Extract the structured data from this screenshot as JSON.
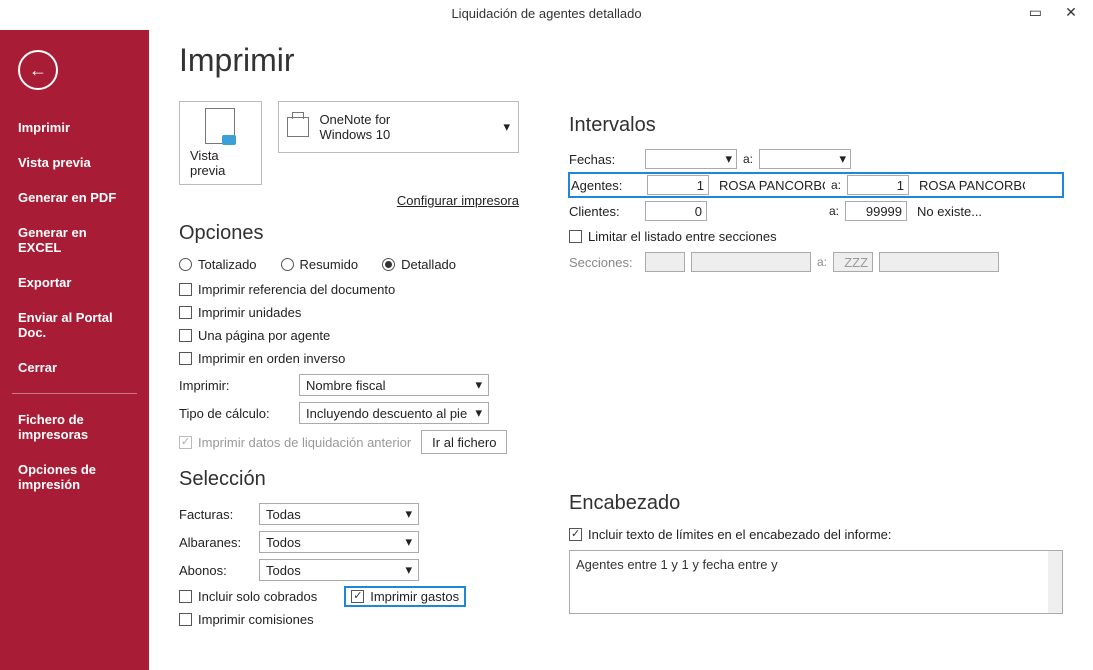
{
  "window": {
    "title": "Liquidación de agentes detallado"
  },
  "sidebar": {
    "items": [
      "Imprimir",
      "Vista previa",
      "Generar en PDF",
      "Generar en EXCEL",
      "Exportar",
      "Enviar al Portal Doc.",
      "Cerrar"
    ],
    "extra": [
      "Fichero de impresoras",
      "Opciones de impresión"
    ]
  },
  "page": {
    "title": "Imprimir",
    "preview_label": "Vista previa",
    "printer_selected": "OneNote for Windows 10",
    "configure_link": "Configurar impresora"
  },
  "opciones": {
    "heading": "Opciones",
    "radios": {
      "totalizado": "Totalizado",
      "resumido": "Resumido",
      "detallado": "Detallado",
      "selected": "detallado"
    },
    "chk_ref": "Imprimir referencia del documento",
    "chk_unidades": "Imprimir unidades",
    "chk_pagina_agente": "Una página por agente",
    "chk_orden_inverso": "Imprimir en orden inverso",
    "imprimir_label": "Imprimir:",
    "imprimir_value": "Nombre fiscal",
    "tipo_label": "Tipo de cálculo:",
    "tipo_value": "Incluyendo descuento al pie",
    "chk_datos_liq": "Imprimir datos de liquidación anterior",
    "ir_fichero": "Ir al fichero"
  },
  "seleccion": {
    "heading": "Selección",
    "facturas_label": "Facturas:",
    "facturas_value": "Todas",
    "albaranes_label": "Albaranes:",
    "albaranes_value": "Todos",
    "abonos_label": "Abonos:",
    "abonos_value": "Todos",
    "chk_solo_cobrados": "Incluir solo cobrados",
    "chk_imprimir_gastos": "Imprimir gastos",
    "chk_imprimir_comisiones": "Imprimir comisiones"
  },
  "intervalos": {
    "heading": "Intervalos",
    "fechas_label": "Fechas:",
    "a_label": "a:",
    "agentes_label": "Agentes:",
    "agente_from_num": "1",
    "agente_from_name": "ROSA PANCORBO",
    "agente_to_num": "1",
    "agente_to_name": "ROSA PANCORBO",
    "clientes_label": "Clientes:",
    "cliente_from_num": "0",
    "cliente_to_num": "99999",
    "cliente_to_name": "No existe...",
    "chk_limitar": "Limitar el listado entre secciones",
    "secciones_label": "Secciones:",
    "secciones_to": "ZZZ"
  },
  "encabezado": {
    "heading": "Encabezado",
    "chk_incluir": "Incluir texto de límites en el encabezado del informe:",
    "text": "Agentes entre 1 y 1 y fecha entre  y"
  }
}
